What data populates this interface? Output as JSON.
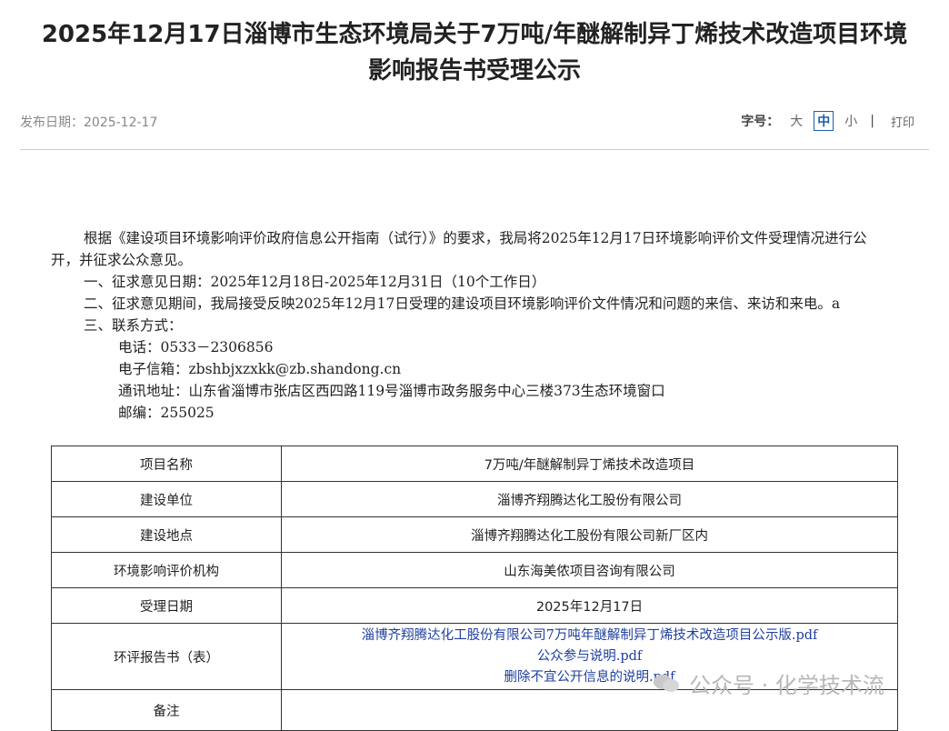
{
  "title_line1": "2025年12月17日淄博市生态环境局关于7万吨/年醚解制异丁烯技术改造项目环境",
  "title_line2": "影响报告书受理公示",
  "publish_date_label": "发布日期：2025-12-17",
  "fontsize": {
    "label": "字号：",
    "large": "大",
    "medium": "中",
    "small": "小",
    "sep": "|",
    "print": "打印"
  },
  "body": {
    "p1": "根据《建设项目环境影响评价政府信息公开指南（试行）》的要求，我局将2025年12月17日环境影响评价文件受理情况进行公开，并征求公众意见。",
    "p2": "一、征求意见日期：2025年12月18日-2025年12月31日（10个工作日）",
    "p3": "二、征求意见期间，我局接受反映2025年12月17日受理的建设项目环境影响评价文件情况和问题的来信、来访和来电。a",
    "p4": "三、联系方式：",
    "phone": "电话：0533－2306856",
    "email": "电子信箱：zbshbjxzxkk@zb.shandong.cn",
    "address": "通讯地址：山东省淄博市张店区西四路119号淄博市政务服务中心三楼373生态环境窗口",
    "postcode": "邮编：255025"
  },
  "table": {
    "rows": [
      {
        "key": "项目名称",
        "value": "7万吨/年醚解制异丁烯技术改造项目"
      },
      {
        "key": "建设单位",
        "value": "淄博齐翔腾达化工股份有限公司"
      },
      {
        "key": "建设地点",
        "value": "淄博齐翔腾达化工股份有限公司新厂区内"
      },
      {
        "key": "环境影响评价机构",
        "value": "山东海美侬项目咨询有限公司"
      },
      {
        "key": "受理日期",
        "value": "2025年12月17日"
      }
    ],
    "report_label": "环评报告书（表）",
    "report_links": [
      "淄博齐翔腾达化工股份有限公司7万吨年醚解制异丁烯技术改造项目公示版.pdf",
      "公众参与说明.pdf",
      "删除不宜公开信息的说明.pdf"
    ],
    "remark_label": "备注",
    "remark_value": ""
  },
  "watermark": "公众号 · 化学技术流"
}
